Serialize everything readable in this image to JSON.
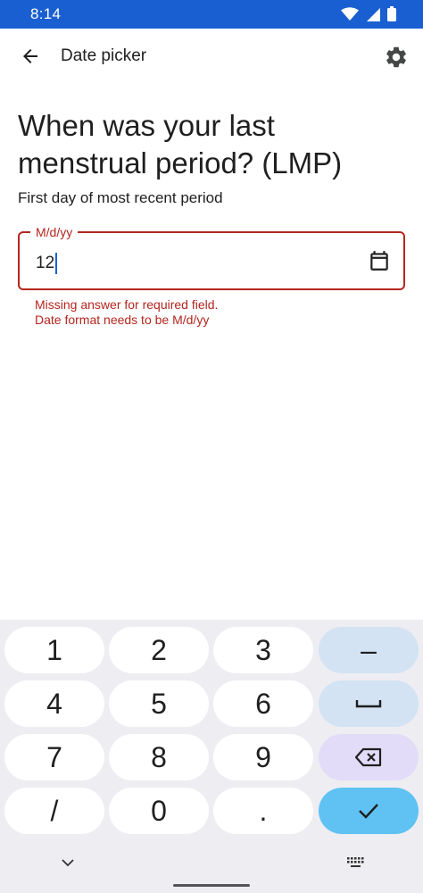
{
  "status_bar": {
    "time": "8:14"
  },
  "app_bar": {
    "title": "Date picker"
  },
  "question": {
    "title": "When was your last menstrual period? (LMP)",
    "subtitle": "First day of most recent period"
  },
  "date_field": {
    "label": "M/d/yy",
    "value": "12",
    "errors": [
      "Missing answer for required field.",
      "Date format needs to be M/d/yy"
    ]
  },
  "keyboard": {
    "keys": [
      "1",
      "2",
      "3",
      "4",
      "5",
      "6",
      "7",
      "8",
      "9",
      "/",
      "0",
      "."
    ],
    "dash": "–"
  },
  "colors": {
    "primary": "#1a5fd1",
    "error": "#b3261e",
    "keyboard_bg": "#eeedf2"
  }
}
